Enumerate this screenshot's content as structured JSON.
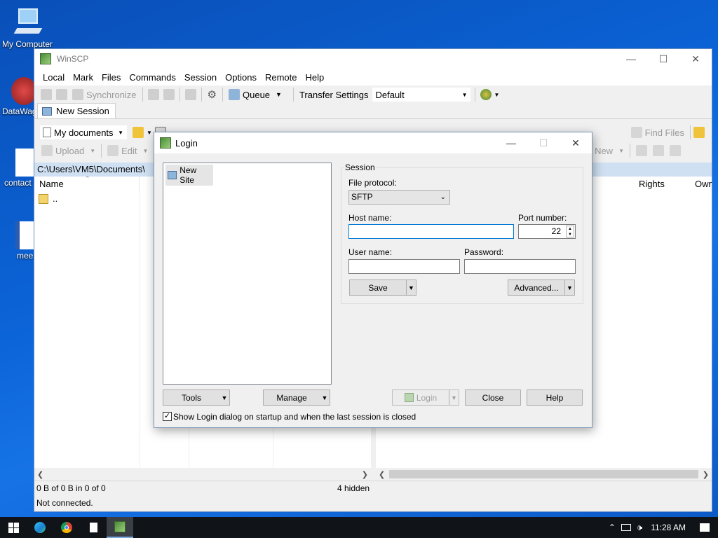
{
  "desktop": {
    "icons": [
      {
        "label": "My Computer"
      },
      {
        "label": "DataWag"
      },
      {
        "label": "contact"
      },
      {
        "label": "mee"
      }
    ]
  },
  "app": {
    "title": "WinSCP",
    "menu": [
      "Local",
      "Mark",
      "Files",
      "Commands",
      "Session",
      "Options",
      "Remote",
      "Help"
    ],
    "toolbar": {
      "synchronize": "Synchronize",
      "queue": "Queue",
      "transfer_settings_label": "Transfer Settings",
      "transfer_settings_value": "Default"
    },
    "tab": {
      "label": "New Session"
    },
    "left_panel": {
      "location": "My documents",
      "upload": "Upload",
      "edit": "Edit",
      "path": "C:\\Users\\VM5\\Documents\\",
      "column_name": "Name",
      "parent_dir": "..",
      "status_size": "0 B of 0 B in 0 of 0",
      "status_hidden": "4 hidden"
    },
    "right_panel": {
      "find_files": "Find Files",
      "new": "New",
      "col_rights": "Rights",
      "col_owner": "Own"
    },
    "status": "Not connected."
  },
  "login": {
    "title": "Login",
    "site": "New Site",
    "session_label": "Session",
    "file_protocol_label": "File protocol:",
    "file_protocol_value": "SFTP",
    "host_label": "Host name:",
    "host_value": "",
    "port_label": "Port number:",
    "port_value": "22",
    "user_label": "User name:",
    "user_value": "",
    "password_label": "Password:",
    "password_value": "",
    "save": "Save",
    "advanced": "Advanced...",
    "tools": "Tools",
    "manage": "Manage",
    "login_btn": "Login",
    "close": "Close",
    "help": "Help",
    "show_on_startup": "Show Login dialog on startup and when the last session is closed",
    "show_on_startup_checked": true
  },
  "taskbar": {
    "time": "11:28 AM"
  }
}
